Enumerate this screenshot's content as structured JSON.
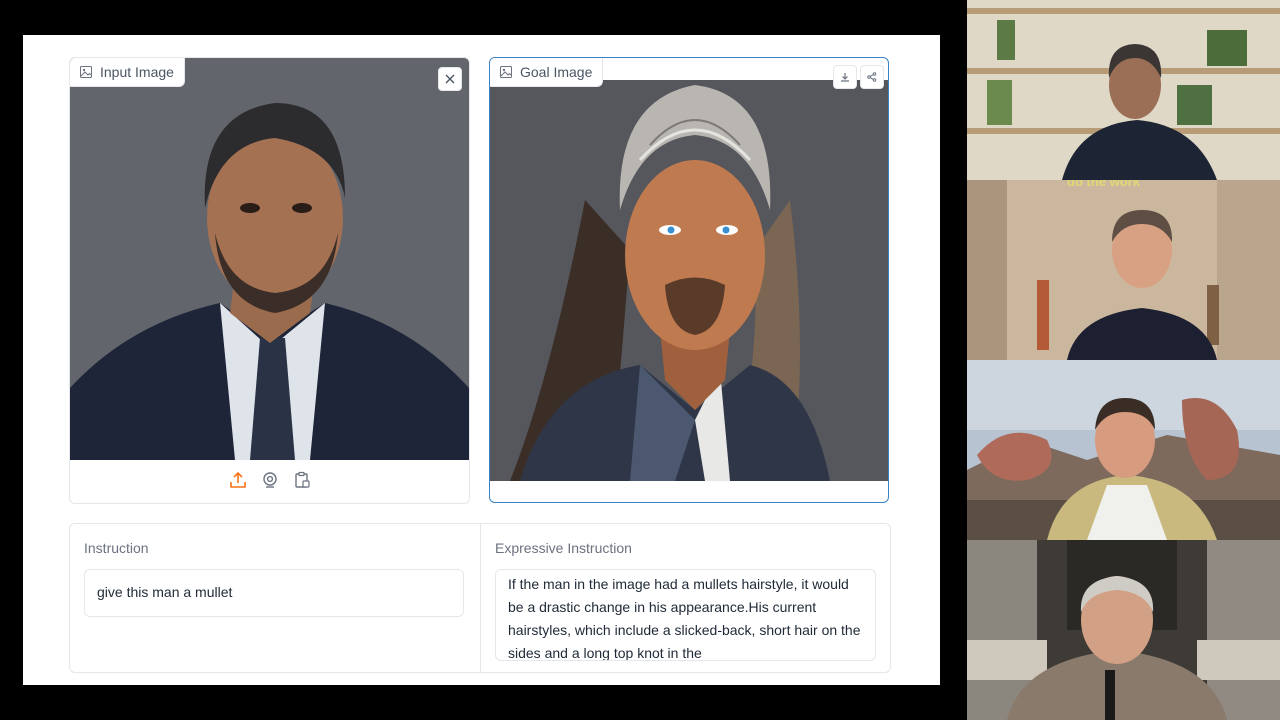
{
  "input_image": {
    "label": "Input Image",
    "icon": "image-icon",
    "actions": [
      "close-icon",
      "upload-icon",
      "webcam-icon",
      "clipboard-icon"
    ]
  },
  "goal_image": {
    "label": "Goal Image",
    "icon": "image-icon",
    "actions": [
      "download-icon",
      "share-icon"
    ]
  },
  "instruction": {
    "label": "Instruction",
    "value": "give this man a mullet"
  },
  "expressive_instruction": {
    "label": "Expressive Instruction",
    "value": "If the man in the image had a mullets hairstyle, it would be a drastic change in his appearance.His current hairstyles, which include a slicked-back, short hair on the sides and a long top knot in the"
  },
  "video_overlay_text": "do the work",
  "colors": {
    "accent": "#f97316",
    "selected_border": "#3b82c4",
    "background": "#000000"
  }
}
